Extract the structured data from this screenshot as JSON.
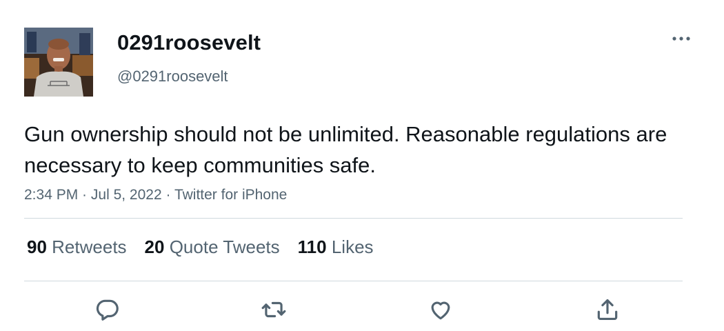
{
  "user": {
    "display_name": "0291roosevelt",
    "handle": "@0291roosevelt"
  },
  "tweet": {
    "text": "Gun ownership should not be unlimited. Reasonable regulations are necessary to keep communities safe.",
    "time": "2:34 PM",
    "date": "Jul 5, 2022",
    "source": "Twitter for iPhone",
    "separator": " · "
  },
  "stats": {
    "retweets_count": "90",
    "retweets_label": "Retweets",
    "quotes_count": "20",
    "quotes_label": "Quote Tweets",
    "likes_count": "110",
    "likes_label": "Likes"
  },
  "actions": {
    "reply": "reply-icon",
    "retweet": "retweet-icon",
    "like": "heart-icon",
    "share": "share-icon"
  },
  "colors": {
    "text_primary": "#0f1419",
    "text_secondary": "#536471",
    "divider": "#cfd9de"
  }
}
